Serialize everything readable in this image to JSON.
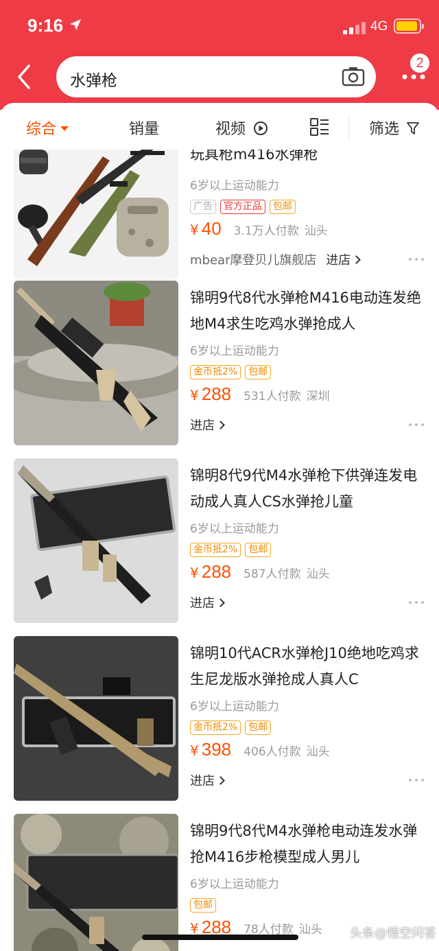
{
  "status": {
    "time": "9:16",
    "network": "4G"
  },
  "header": {
    "search_query": "水弹枪",
    "badge_count": "2"
  },
  "sort_tabs": [
    {
      "label": "综合",
      "active": true
    },
    {
      "label": "销量",
      "active": false
    },
    {
      "label": "视频",
      "active": false
    },
    {
      "label": "筛选",
      "active": false
    }
  ],
  "products": [
    {
      "title": "玩具枪m416水弹枪",
      "ability": "6岁以上运动能力",
      "tags": [
        "广告",
        "官方正品",
        "包邮"
      ],
      "yen": "¥",
      "price": "40",
      "paid": "3.1万人付款",
      "city": "汕头",
      "shop": "mbear摩登贝儿旗舰店",
      "enter": "进店"
    },
    {
      "title": "锦明9代8代水弹枪M416电动连发绝地M4求生吃鸡水弹抢成人",
      "ability": "6岁以上运动能力",
      "tags": [
        "金币抵2%",
        "包邮"
      ],
      "yen": "¥",
      "price": "288",
      "paid": "531人付款",
      "city": "深圳",
      "shop": "",
      "enter": "进店"
    },
    {
      "title": "锦明8代9代M4水弹枪下供弹连发电动成人真人CS水弹抢儿童",
      "ability": "6岁以上运动能力",
      "tags": [
        "金币抵2%",
        "包邮"
      ],
      "yen": "¥",
      "price": "288",
      "paid": "587人付款",
      "city": "汕头",
      "shop": "",
      "enter": "进店"
    },
    {
      "title": "锦明10代ACR水弹枪J10绝地吃鸡求生尼龙版水弹抢成人真人C",
      "ability": "6岁以上运动能力",
      "tags": [
        "金币抵2%",
        "包邮"
      ],
      "yen": "¥",
      "price": "398",
      "paid": "406人付款",
      "city": "汕头",
      "shop": "",
      "enter": "进店"
    },
    {
      "title": "锦明9代8代M4水弹枪电动连发水弹抢M416步枪模型成人男儿",
      "ability": "6岁以上运动能力",
      "tags": [
        "包邮"
      ],
      "yen": "¥",
      "price": "288",
      "paid": "78人付款",
      "city": "汕头",
      "shop": "",
      "enter": ""
    }
  ],
  "watermark": "头条@悟空问答",
  "colors": {
    "header_red": "#ef3b45",
    "price_orange": "#ff5000",
    "tag_orange": "#f08a00"
  }
}
